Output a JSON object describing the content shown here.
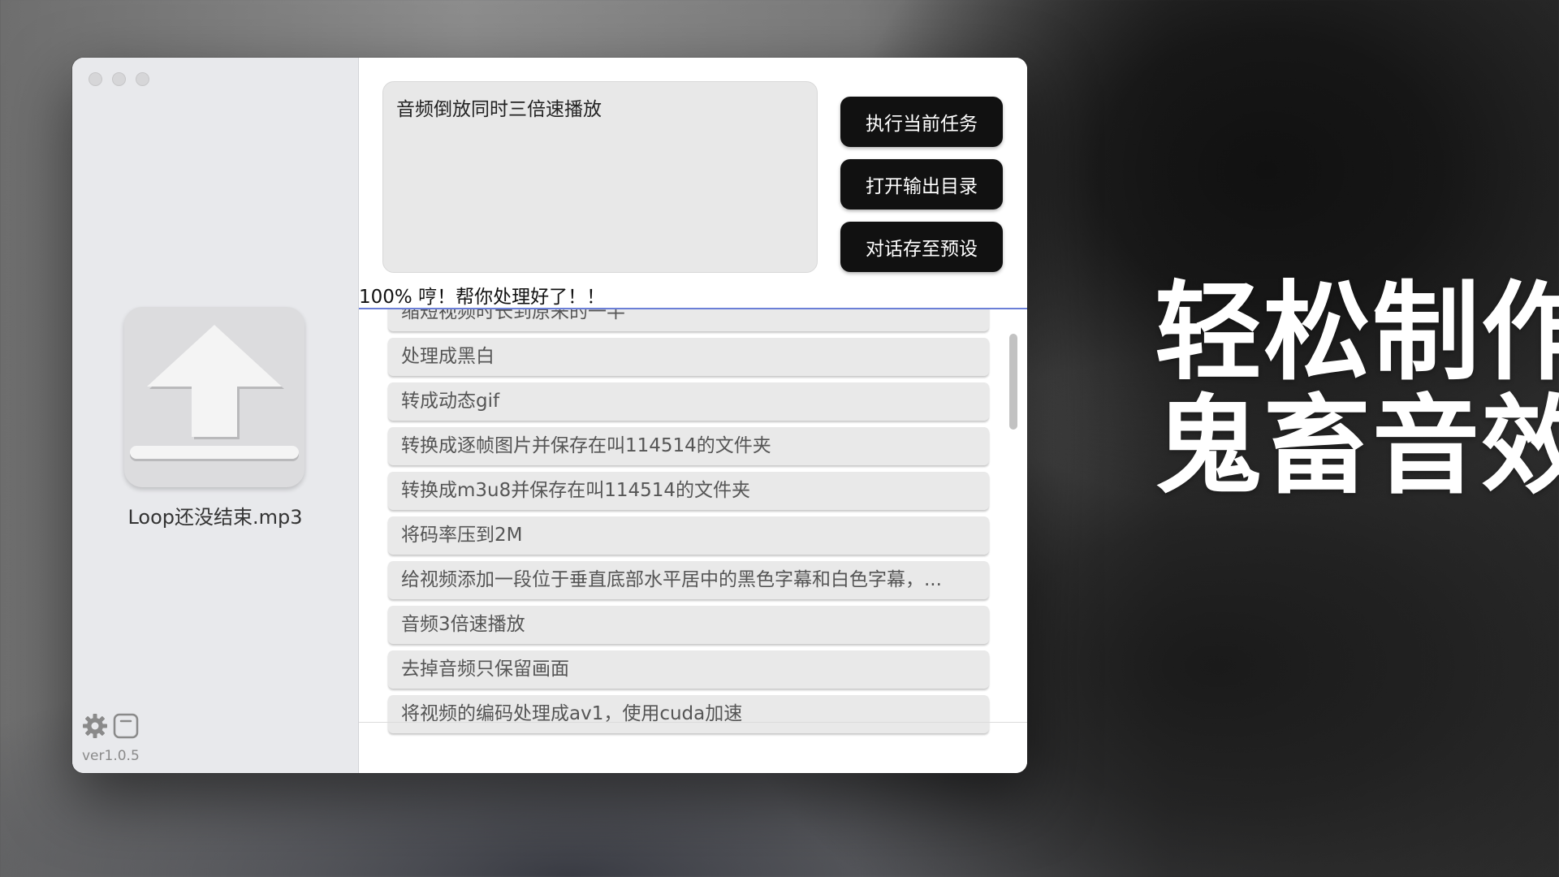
{
  "promo": {
    "line1": "轻松制作",
    "line2": "鬼畜音效"
  },
  "window": {
    "traffic_lights": [
      "close",
      "minimize",
      "zoom"
    ]
  },
  "sidebar": {
    "upload_icon": "upload-arrow-icon",
    "file_name": "Loop还没结束.mp3",
    "settings_icon": "gear-icon",
    "window_icon": "window-icon",
    "version": "ver1.0.5"
  },
  "main": {
    "prompt_text": "音频倒放同时三倍速播放",
    "buttons": {
      "run": "执行当前任务",
      "open_output": "打开输出目录",
      "save_preset": "对话存至预设"
    },
    "status": "100% 哼！帮你处理好了！！",
    "presets": [
      "缩短视频时长到原来的一半",
      "处理成黑白",
      "转成动态gif",
      "转换成逐帧图片并保存在叫114514的文件夹",
      "转换成m3u8并保存在叫114514的文件夹",
      "将码率压到2M",
      "给视频添加一段位于垂直底部水平居中的黑色字幕和白色字幕，...",
      "音频3倍速播放",
      "去掉音频只保留画面",
      "将视频的编码处理成av1，使用cuda加速"
    ]
  },
  "colors": {
    "button_bg": "#111111",
    "divider": "#6b7fd7",
    "sidebar_bg": "#e8e9ec"
  }
}
